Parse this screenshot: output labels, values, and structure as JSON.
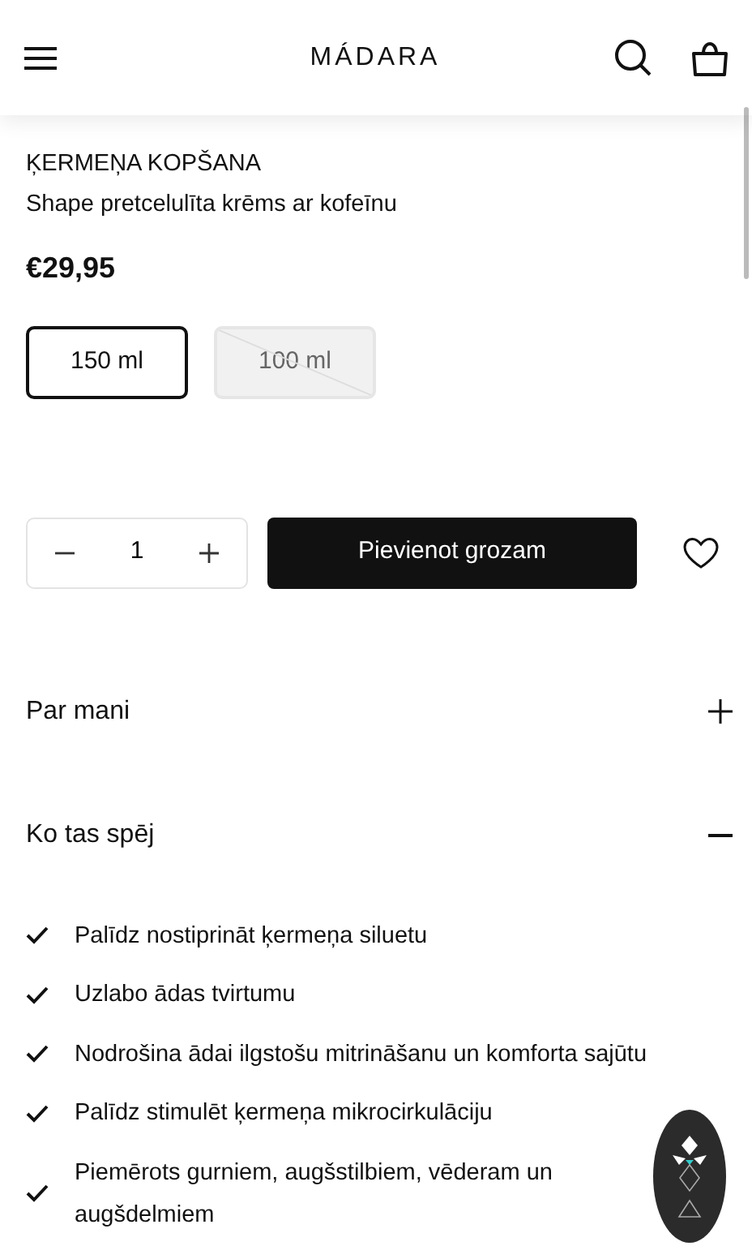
{
  "header": {
    "logo": "MÁDARA"
  },
  "product": {
    "category": "ĶERMEŅA KOPŠANA",
    "title": "Shape pretcelulīta krēms ar kofeīnu",
    "price": "€29,95"
  },
  "sizes": [
    {
      "label": "150 ml",
      "selected": true,
      "disabled": false
    },
    {
      "label": "100 ml",
      "selected": false,
      "disabled": true
    }
  ],
  "quantity": {
    "value": "1"
  },
  "add_to_cart": "Pievienot grozam",
  "accordions": [
    {
      "title": "Par mani",
      "expanded": false
    },
    {
      "title": "Ko tas spēj",
      "expanded": true,
      "items": [
        "Palīdz nostiprināt ķermeņa siluetu",
        "Uzlabo ādas tvirtumu",
        "Nodrošina ādai ilgstošu mitrināšanu un komforta sajūtu",
        "Palīdz stimulēt ķermeņa mikrocirkulāciju",
        "Piemērots gurniem, augšstilbiem, vēderam un augšdelmiem"
      ]
    }
  ]
}
